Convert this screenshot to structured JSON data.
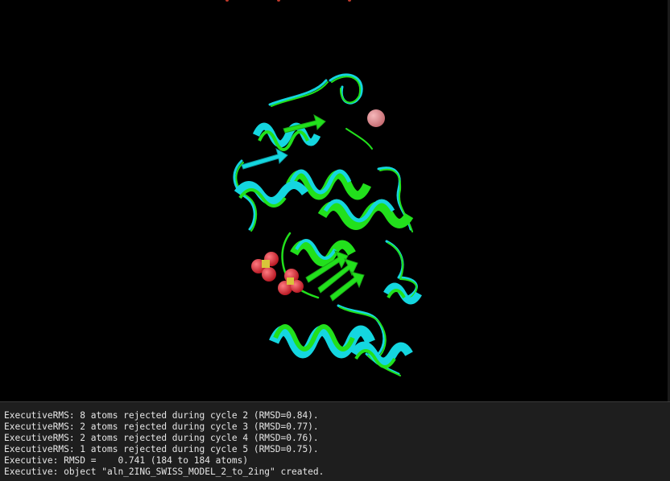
{
  "window": {
    "background_color": "#000000",
    "console_background_color": "#1e1e1e"
  },
  "viewer": {
    "scene": "protein-structure-alignment",
    "colors": {
      "structure_a": "#22e01c",
      "structure_b": "#14d6e0",
      "ion_sphere": "#e88a8f",
      "oxygen_sphere": "#e8303b",
      "sulfur": "#d9c53a"
    }
  },
  "console": {
    "lines": [
      "ExecutiveRMS: 8 atoms rejected during cycle 2 (RMSD=0.84).",
      "ExecutiveRMS: 2 atoms rejected during cycle 3 (RMSD=0.77).",
      "ExecutiveRMS: 2 atoms rejected during cycle 4 (RMSD=0.76).",
      "ExecutiveRMS: 1 atoms rejected during cycle 5 (RMSD=0.75).",
      "Executive: RMSD =    0.741 (184 to 184 atoms)",
      "Executive: object \"aln_2ING_SWISS_MODEL_2_to_2ing\" created."
    ]
  }
}
